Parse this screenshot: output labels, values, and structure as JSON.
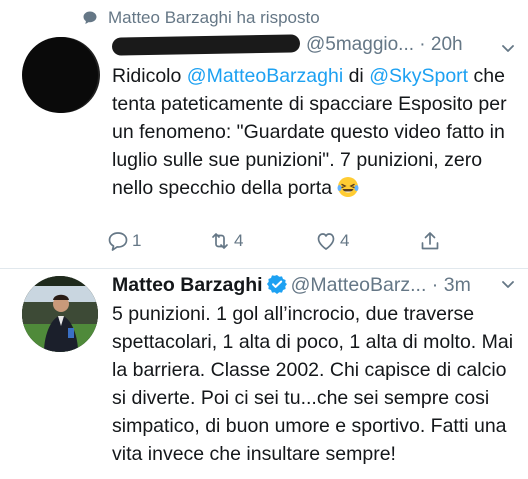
{
  "context": {
    "text": "Matteo Barzaghi ha risposto",
    "icon": "reply-bubble-icon"
  },
  "tweet1": {
    "handle_visible": "@5maggio...",
    "time": "20h",
    "text": {
      "p1": "Ridicolo ",
      "mention1": "@MatteoBarzaghi",
      "p2": " di ",
      "mention2": "@SkySport",
      "p3": " che tenta pateticamente di spacciare Esposito per un fenomeno: \"Guardate questo video fatto in luglio sulle sue punizioni\". 7 punizioni, zero nello specchio della porta "
    },
    "actions": {
      "reply_count": "1",
      "retweet_count": "4",
      "like_count": "4"
    }
  },
  "tweet2": {
    "name": "Matteo Barzaghi",
    "handle": "@MatteoBarz...",
    "time": "3m",
    "text": "5 punizioni. 1 gol all’incrocio, due traverse spettacolari, 1 alta di poco, 1 alta di molto. Mai la barriera. Classe 2002. Chi capisce di calcio si diverte. Poi ci sei tu...che sei sempre cosi simpatico, di buon umore e sportivo. Fatti una vita invece che insultare sempre!"
  },
  "colors": {
    "link": "#1da1f2",
    "muted": "#657786",
    "text": "#14171a"
  }
}
